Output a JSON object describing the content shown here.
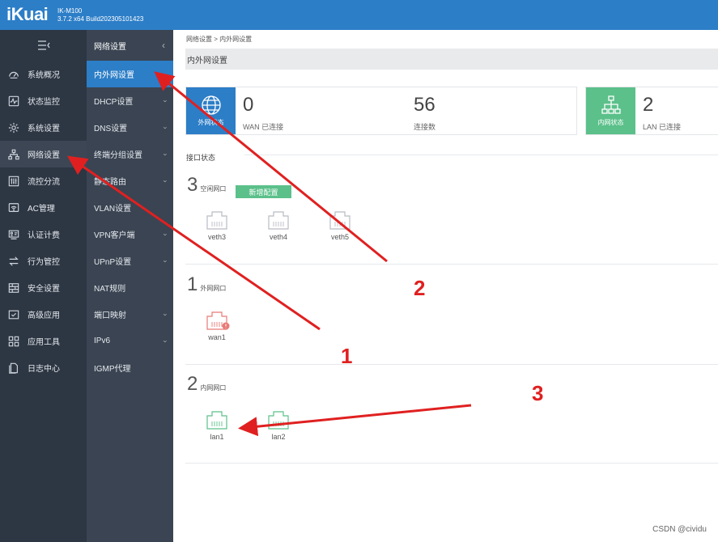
{
  "header": {
    "logo": "iKuai",
    "model": "IK-M100",
    "build": "3.7.2 x64 Build202305101423"
  },
  "sidebar": {
    "toggle_icon": "menu-collapse-icon",
    "items": [
      {
        "label": "系统概况",
        "icon": "gauge-icon"
      },
      {
        "label": "状态监控",
        "icon": "pulse-icon"
      },
      {
        "label": "系统设置",
        "icon": "gear-icon"
      },
      {
        "label": "网络设置",
        "icon": "network-icon",
        "active": true
      },
      {
        "label": "流控分流",
        "icon": "sliders-icon"
      },
      {
        "label": "AC管理",
        "icon": "wifi-icon"
      },
      {
        "label": "认证计费",
        "icon": "id-card-icon"
      },
      {
        "label": "行为管控",
        "icon": "arrows-icon"
      },
      {
        "label": "安全设置",
        "icon": "firewall-icon"
      },
      {
        "label": "高级应用",
        "icon": "calendar-check-icon"
      },
      {
        "label": "应用工具",
        "icon": "apps-icon"
      },
      {
        "label": "日志中心",
        "icon": "document-icon"
      }
    ]
  },
  "subnav": {
    "title": "网络设置",
    "items": [
      {
        "label": "内外网设置",
        "active": true,
        "chevron": false
      },
      {
        "label": "DHCP设置",
        "chevron": true
      },
      {
        "label": "DNS设置",
        "chevron": true
      },
      {
        "label": "终端分组设置",
        "chevron": true
      },
      {
        "label": "静态路由",
        "chevron": true
      },
      {
        "label": "VLAN设置",
        "chevron": false
      },
      {
        "label": "VPN客户端",
        "chevron": true
      },
      {
        "label": "UPnP设置",
        "chevron": true
      },
      {
        "label": "NAT规则",
        "chevron": false
      },
      {
        "label": "端口映射",
        "chevron": true
      },
      {
        "label": "IPv6",
        "chevron": true
      },
      {
        "label": "IGMP代理",
        "chevron": false
      }
    ]
  },
  "main": {
    "breadcrumb": "网络设置 > 内外网设置",
    "page_title": "内外网设置",
    "wan_card": {
      "icon_label": "外网状态",
      "count": "0",
      "count_label": "WAN 已连接",
      "conn": "56",
      "conn_label": "连接数",
      "color": "#2c7ec7"
    },
    "lan_card": {
      "icon_label": "内网状态",
      "count": "2",
      "count_label": "LAN 已连接",
      "color": "#5bc08a"
    },
    "section_label": "接口状态",
    "idle_group": {
      "count": "3",
      "label": "空闲网口",
      "button": "新增配置",
      "ports": [
        "veth3",
        "veth4",
        "veth5"
      ]
    },
    "wan_group": {
      "count": "1",
      "label": "外网网口",
      "ports": [
        "wan1"
      ]
    },
    "lan_group": {
      "count": "2",
      "label": "内网网口",
      "ports": [
        "lan1",
        "lan2"
      ]
    }
  },
  "annotations": {
    "n1": "1",
    "n2": "2",
    "n3": "3",
    "color": "#e02020"
  },
  "watermark": "CSDN @cividu"
}
